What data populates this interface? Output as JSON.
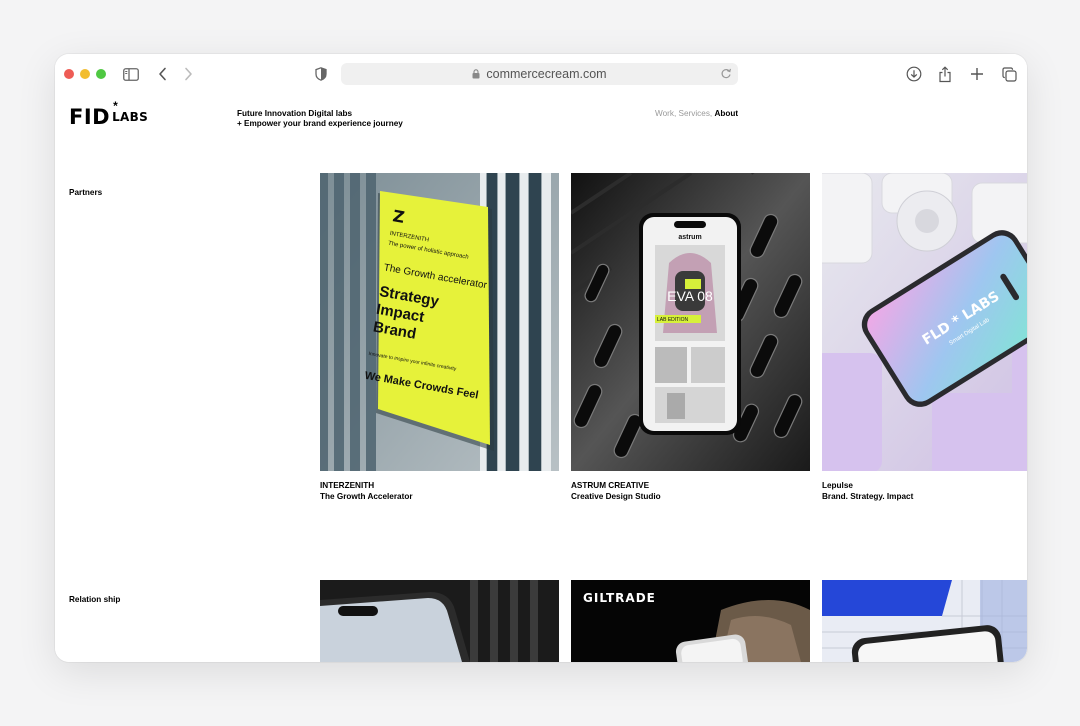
{
  "browser": {
    "url": "commercecream.com"
  },
  "site": {
    "logo_text": "FID",
    "logo_star": "*",
    "logo_labs": "LABS",
    "tagline_line1": "Future Innovation Digital labs",
    "tagline_line2": "+ Empower your brand experience journey",
    "nav": {
      "work": "Work,",
      "services": "Services,",
      "about": "About"
    }
  },
  "sections": {
    "partners": "Partners",
    "relationship": "Relation ship"
  },
  "cards": [
    {
      "title": "INTERZENITH",
      "subtitle": "The Growth Accelerator",
      "poster": {
        "brand": "INTERZENITH",
        "tagline": "The power of holistic approach",
        "headline": "The Growth accelerator",
        "line1": "Strategy",
        "line2": "Impact",
        "line3": "Brand",
        "small": "Innovate to inspire your infinite creativity",
        "slogan": "We Make Crowds Feel"
      }
    },
    {
      "title": "ASTRUM CREATIVE",
      "subtitle": "Creative Design Studio",
      "phone": {
        "brand": "astrum",
        "big": "EVA 08",
        "small": "LAB EDITION"
      }
    },
    {
      "title": "Lepulse",
      "subtitle": "Brand. Strategy. Impact",
      "phone": {
        "brand": "FLD * LABS",
        "tag": "Smart Digital Lab"
      }
    }
  ],
  "second_row": {
    "giltrade": "GILTRADE"
  },
  "colors": {
    "accent_yellow": "#e6f23a",
    "lavender": "#d9c4ef",
    "blue": "#2547d8"
  }
}
